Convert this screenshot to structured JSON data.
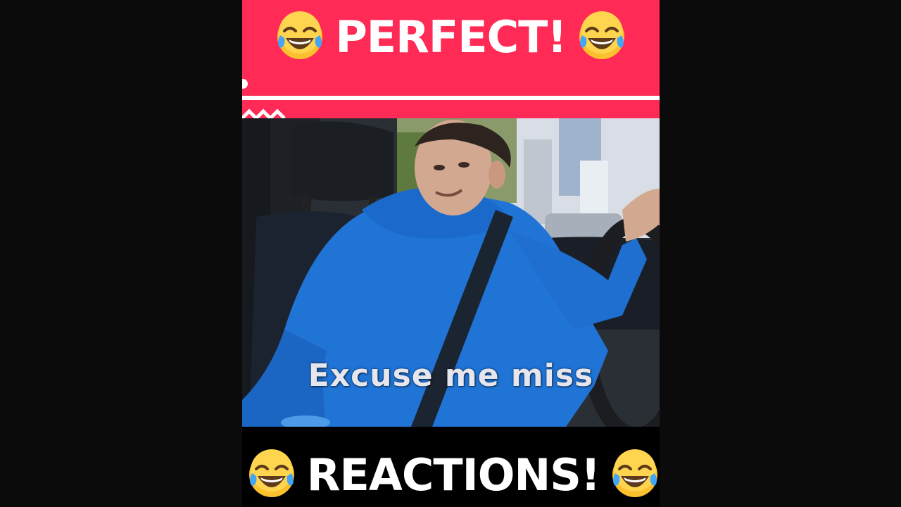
{
  "top_banner": {
    "headline": "PERFECT!",
    "emoji_left": "tears-of-joy-emoji",
    "emoji_right": "tears-of-joy-emoji",
    "background_color": "#ff2a55"
  },
  "video": {
    "subtitle": "Excuse me miss"
  },
  "bottom_banner": {
    "headline": "REACTIONS!",
    "emoji_left": "tears-of-joy-emoji",
    "emoji_right": "tears-of-joy-emoji",
    "background_color": "#000000"
  }
}
